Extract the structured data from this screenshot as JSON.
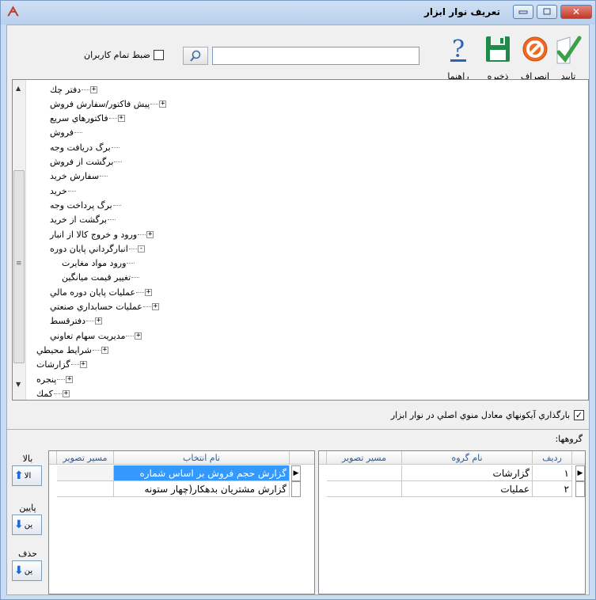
{
  "window": {
    "title": "تعريف نوار ابزار",
    "close_glyph": "✕",
    "logo": "ᗅ"
  },
  "toolbar": {
    "confirm_label": "تایید",
    "cancel_label": "انصراف",
    "save_label": "ذخيره",
    "help_label": "راهنما",
    "search_value": "",
    "all_users_label": "ضبط تمام کاربران"
  },
  "tree": {
    "nodes": [
      {
        "label": "دفتر چك",
        "expander": "+",
        "level": 1
      },
      {
        "label": "پيش فاكتور/سفارش فروش",
        "expander": "+",
        "level": 1
      },
      {
        "label": "فاكتورهاي سريع",
        "expander": "+",
        "level": 1
      },
      {
        "label": "فروش",
        "expander": "",
        "level": 1
      },
      {
        "label": "برگ دريافت وجه",
        "expander": "",
        "level": 1
      },
      {
        "label": "برگشت از فروش",
        "expander": "",
        "level": 1
      },
      {
        "label": "سفارش خريد",
        "expander": "",
        "level": 1
      },
      {
        "label": "خريد",
        "expander": "",
        "level": 1
      },
      {
        "label": "برگ پرداخت وجه",
        "expander": "",
        "level": 1
      },
      {
        "label": "برگشت از خريد",
        "expander": "",
        "level": 1
      },
      {
        "label": "ورود و خروج كالا از انبار",
        "expander": "+",
        "level": 1
      },
      {
        "label": "انبارگرداني پايان دوره",
        "expander": "-",
        "level": 1
      },
      {
        "label": "ورود مواد مغايرت",
        "expander": "",
        "level": 2
      },
      {
        "label": "تغيير قيمت ميانگين",
        "expander": "",
        "level": 2
      },
      {
        "label": "عمليات پايان دوره مالي",
        "expander": "+",
        "level": 1
      },
      {
        "label": "عمليات حسابداري صنعتي",
        "expander": "+",
        "level": 1
      },
      {
        "label": "دفترقسط",
        "expander": "+",
        "level": 1
      },
      {
        "label": "مديريت سهام تعاوني",
        "expander": "+",
        "level": 1
      },
      {
        "label": "شرايط محيطي",
        "expander": "+",
        "level": 0
      },
      {
        "label": "گزارشات",
        "expander": "+",
        "level": 0
      },
      {
        "label": "پنجره",
        "expander": "+",
        "level": 0
      },
      {
        "label": "كمك",
        "expander": "+",
        "level": 0
      }
    ]
  },
  "icons_option": {
    "label": "بارگذاري آيكونهاي معادل منوي اصلي در نوار ابزار",
    "checked_mark": "✓"
  },
  "groups": {
    "label": "گروهها:",
    "columns": [
      "رديف",
      "نام گروه",
      "مسير تصوير"
    ],
    "rows": [
      {
        "index": "١",
        "name": "گزارشات",
        "path": ""
      },
      {
        "index": "٢",
        "name": "عمليات",
        "path": ""
      }
    ]
  },
  "selections": {
    "columns": [
      "نام انتخاب",
      "مسير تصوير"
    ],
    "rows": [
      {
        "name": "گزارش حجم فروش بر اساس شماره",
        "path": ""
      },
      {
        "name": "گزارش مشتريان بدهكار(چهار ستونه",
        "path": ""
      }
    ]
  },
  "side_buttons": {
    "up_label": "بالا",
    "up_text": "الا",
    "down_label": "پایین",
    "down_text": "ين",
    "delete_label": "حذف",
    "delete_text": "ين"
  },
  "colors": {
    "selection": "#3399ff",
    "title_bar": "#c9dcf0",
    "close_button": "#c0392b"
  }
}
